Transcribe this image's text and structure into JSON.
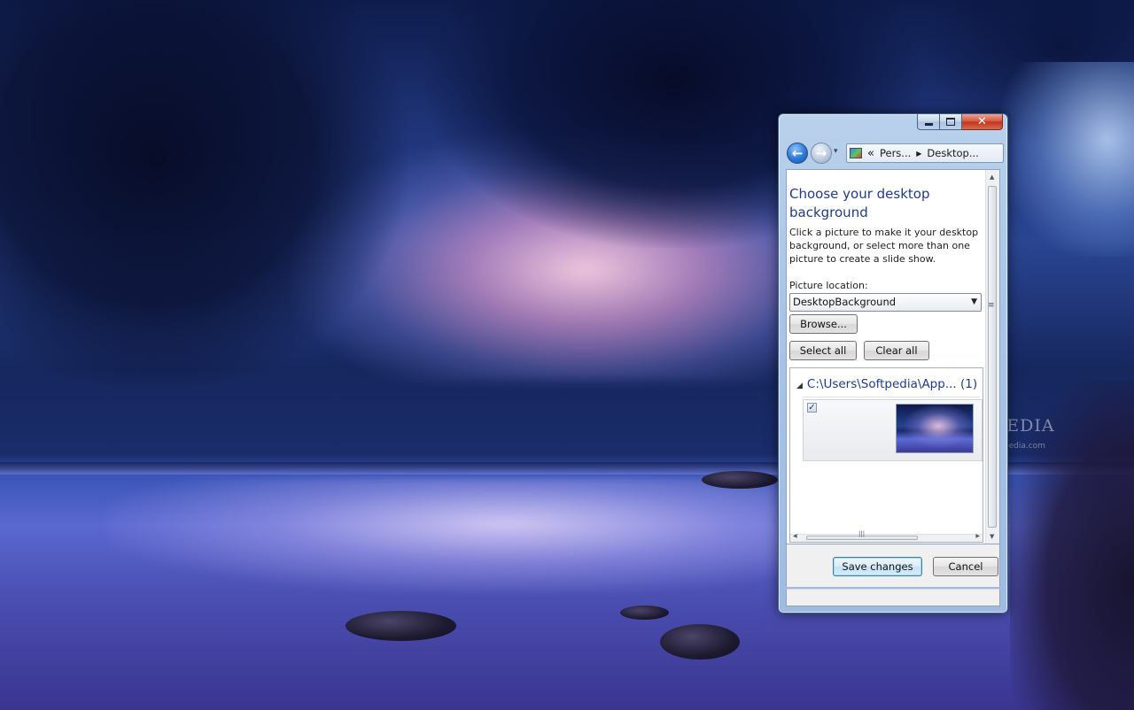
{
  "desktop": {
    "watermark": "SOFTPEDIA",
    "watermark_url": "www.softpedia.com"
  },
  "window": {
    "caption": {
      "minimize": "minimize-icon",
      "maximize": "maximize-icon",
      "close": "✕"
    },
    "nav": {
      "back": "←",
      "forward": "→",
      "recent": "▾",
      "address": {
        "chevrons": "«",
        "crumbs": [
          "Pers...",
          "Desktop..."
        ]
      }
    },
    "content": {
      "heading": "Choose your desktop background",
      "description": "Click a picture to make it your desktop background, or select more than one picture to create a slide show.",
      "picture_location_label": "Picture location:",
      "picture_location_value": "DesktopBackground",
      "browse_label": "Browse...",
      "select_all_label": "Select all",
      "clear_all_label": "Clear all",
      "group": {
        "title": "C:\\Users\\Softpedia\\App... (1)",
        "items": [
          {
            "checked": true
          }
        ]
      }
    },
    "footer": {
      "save_label": "Save changes",
      "cancel_label": "Cancel"
    }
  }
}
